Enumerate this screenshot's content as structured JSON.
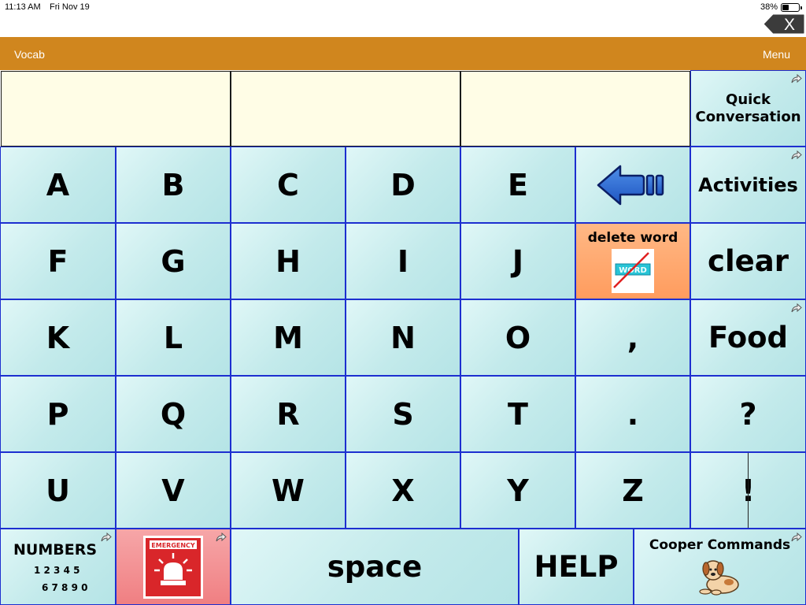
{
  "status_bar": {
    "time": "11:13 AM",
    "date": "Fri Nov 19",
    "battery_percent": "38%",
    "battery_level": 0.38
  },
  "title_bar": {
    "left_label": "Vocab",
    "menu_label": "Menu",
    "close_label": "X"
  },
  "colors": {
    "title_bar": "#d0861e",
    "cell_border": "#1d2fd0",
    "message_bg": "#fffde6",
    "delete_word_bg": "#ff9c5e",
    "emergency_bg": "#f07f82"
  },
  "board": {
    "quick_conversation": {
      "line1": "Quick",
      "line2": "Conversation"
    },
    "row1": [
      "A",
      "B",
      "C",
      "D",
      "E"
    ],
    "row2": [
      "F",
      "G",
      "H",
      "I",
      "J"
    ],
    "row3": [
      "K",
      "L",
      "M",
      "N",
      "O"
    ],
    "row4": [
      "P",
      "Q",
      "R",
      "S",
      "T"
    ],
    "row5": [
      "U",
      "V",
      "W",
      "X",
      "Y",
      "Z"
    ],
    "backspace_icon": "backspace-arrow-icon",
    "activities": "Activities",
    "delete_word": "delete word",
    "delete_word_icon_text": "WORD",
    "clear": "clear",
    "comma": ",",
    "food": "Food",
    "period": ".",
    "question": "?",
    "exclamation": "!",
    "numbers": {
      "title": "NUMBERS",
      "line1": "1 2 3 4 5",
      "line2": "6 7 8 9 0"
    },
    "emergency_sign_text": "EMERGENCY",
    "space": "space",
    "help": "HELP",
    "cooper_commands": "Cooper Commands"
  }
}
